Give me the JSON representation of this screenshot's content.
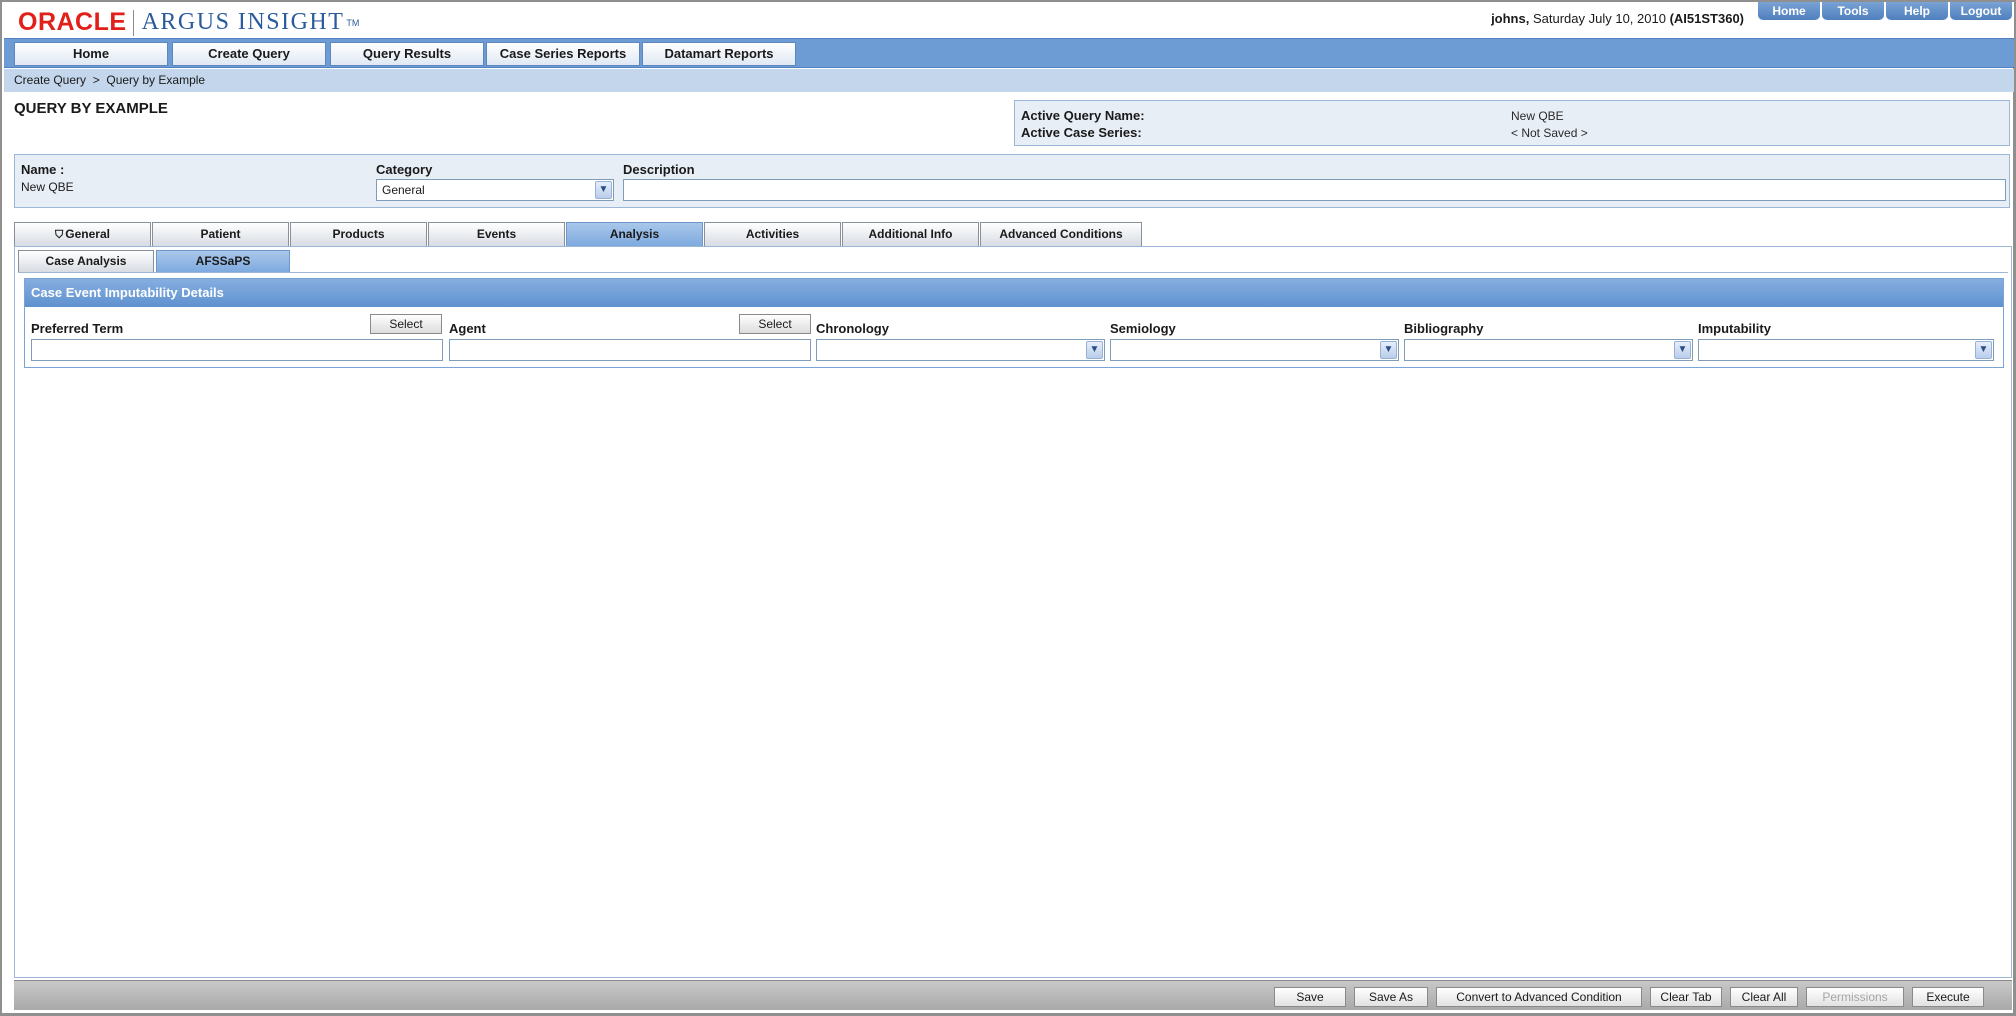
{
  "app": {
    "logo_oracle": "ORACLE",
    "logo_product": "ARGUS INSIGHT",
    "logo_tm": "TM"
  },
  "user_info": {
    "username": "johns,",
    "date": "Saturday July 10, 2010",
    "env": "(AI51ST360)"
  },
  "util_tabs": [
    "Home",
    "Tools",
    "Help",
    "Logout"
  ],
  "nav": [
    "Home",
    "Create Query",
    "Query Results",
    "Case Series Reports",
    "Datamart Reports"
  ],
  "breadcrumb": "Create Query  >  Query by Example",
  "page_title": "QUERY BY EXAMPLE",
  "active": {
    "query_label": "Active Query Name:",
    "query_value": "New QBE",
    "series_label": "Active Case Series:",
    "series_value": "< Not Saved >"
  },
  "query_info": {
    "name_label": "Name :",
    "name_value": "New QBE",
    "category_label": "Category",
    "category_value": "General",
    "description_label": "Description",
    "description_value": ""
  },
  "tabs": [
    "General",
    "Patient",
    "Products",
    "Events",
    "Analysis",
    "Activities",
    "Additional Info",
    "Advanced Conditions"
  ],
  "active_tab": "Analysis",
  "subtabs": [
    "Case Analysis",
    "AFSSaPS"
  ],
  "active_subtab": "AFSSaPS",
  "section": {
    "title": "Case Event Imputability Details",
    "select_label": "Select",
    "fields": {
      "preferred_term": "Preferred Term",
      "agent": "Agent",
      "chronology": "Chronology",
      "semiology": "Semiology",
      "bibliography": "Bibliography",
      "imputability": "Imputability"
    }
  },
  "footer_buttons": {
    "save": "Save",
    "save_as": "Save As",
    "convert": "Convert to Advanced Condition",
    "clear_tab": "Clear Tab",
    "clear_all": "Clear All",
    "permissions": "Permissions",
    "execute": "Execute"
  },
  "colors": {
    "brand_red": "#e2201a",
    "nav_blue": "#6c9cd3",
    "section_blue": "#5f91cf"
  },
  "icons": {
    "dropdown": "chevron-down-icon",
    "filter": "filter-icon"
  }
}
